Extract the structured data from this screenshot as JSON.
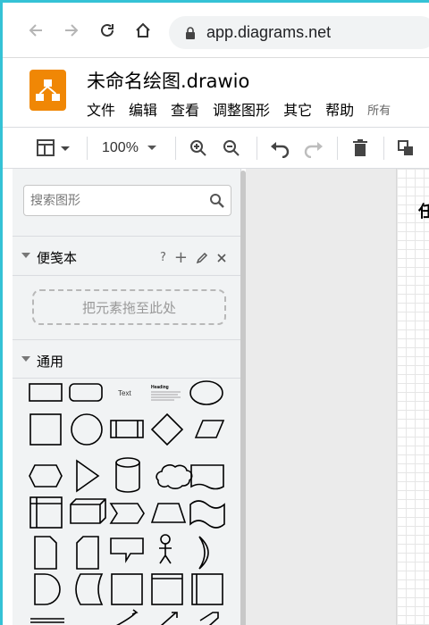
{
  "browser": {
    "url": "app.diagrams.net"
  },
  "app": {
    "title": "未命名绘图.drawio",
    "menu": [
      "文件",
      "编辑",
      "查看",
      "调整图形",
      "其它",
      "帮助"
    ],
    "menu_extra": "所有"
  },
  "toolbar": {
    "zoom": "100%"
  },
  "sidebar": {
    "search_placeholder": "搜索图形",
    "scratchpad": {
      "title": "便笺本",
      "help": "?",
      "add": "+",
      "drop_hint": "把元素拖至此处"
    },
    "general": {
      "title": "通用",
      "text_shape_label": "Text",
      "heading_shape_label": "Heading"
    }
  },
  "canvas": {
    "visible_text": "任"
  },
  "colors": {
    "accent_border": "#35c2d6",
    "logo": "#f08705"
  }
}
